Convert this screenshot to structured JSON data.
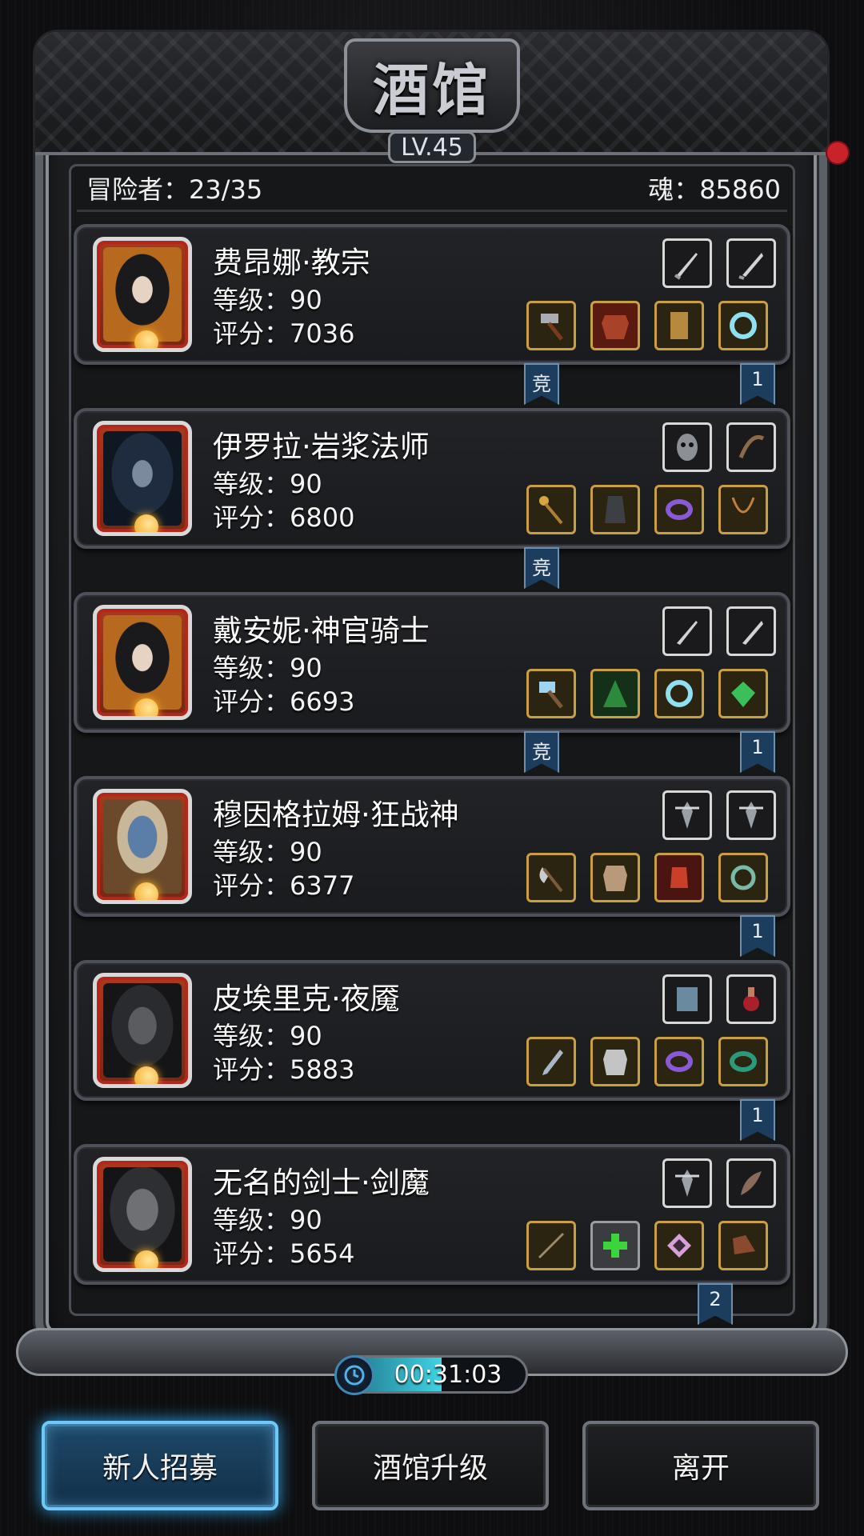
{
  "tavern": {
    "title": "酒馆",
    "level": "LV.45",
    "adventurers": "冒险者：23/35",
    "soul": "魂：85860"
  },
  "heroes": [
    {
      "name": "费昂娜·教宗",
      "level": "等级：90",
      "score": "评分：7036",
      "ribbons": [
        "竞",
        "1"
      ]
    },
    {
      "name": "伊罗拉·岩浆法师",
      "level": "等级：90",
      "score": "评分：6800",
      "ribbons": [
        "竞"
      ]
    },
    {
      "name": "戴安妮·神官骑士",
      "level": "等级：90",
      "score": "评分：6693",
      "ribbons": [
        "竞",
        "1"
      ]
    },
    {
      "name": "穆因格拉姆·狂战神",
      "level": "等级：90",
      "score": "评分：6377",
      "ribbons": [
        "1"
      ]
    },
    {
      "name": "皮埃里克·夜魇",
      "level": "等级：90",
      "score": "评分：5883",
      "ribbons": [
        "1"
      ]
    },
    {
      "name": "无名的剑士·剑魔",
      "level": "等级：90",
      "score": "评分：5654",
      "ribbons": [
        "2"
      ]
    }
  ],
  "timer": {
    "text": "00:31:03"
  },
  "buttons": {
    "recruit": "新人招募",
    "upgrade": "酒馆升级",
    "leave": "离开"
  },
  "colors": {
    "ribbon": "#1d3d5e",
    "active_button": "#1d4868",
    "portrait_border": "#b3261a",
    "gear_border": "#c9a040"
  }
}
